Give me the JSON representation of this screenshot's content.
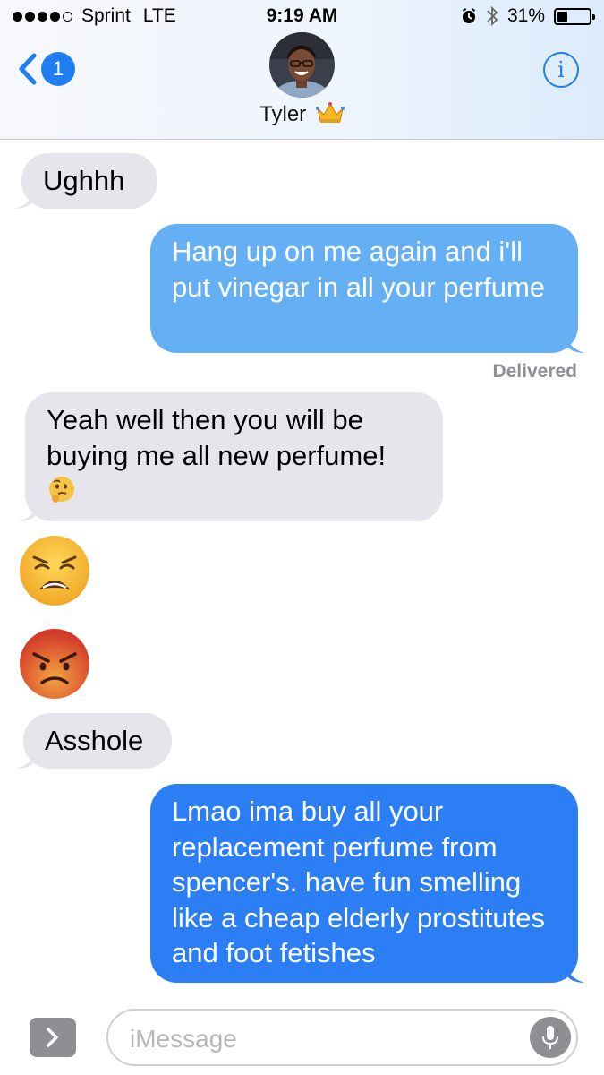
{
  "status_bar": {
    "carrier": "Sprint",
    "network": "LTE",
    "time": "9:19 AM",
    "battery": "31%",
    "battery_level": 0.31
  },
  "header": {
    "back_badge": "1",
    "contact_name": "Tyler",
    "info_glyph": "i"
  },
  "messages": [
    {
      "side": "incoming",
      "text": "Ughhh"
    },
    {
      "side": "outgoing",
      "text": "Hang up on me again and i'll put vinegar in all your perfume"
    },
    {
      "side": "incoming",
      "text": "Yeah well then you will be buying me all new perfume!",
      "emoji": "thinking-face"
    },
    {
      "side": "incoming",
      "emoji": "weary-face"
    },
    {
      "side": "incoming",
      "emoji": "angry-face"
    },
    {
      "side": "incoming",
      "text": "Asshole"
    },
    {
      "side": "outgoing",
      "text": "Lmao ima buy all your replacement perfume from spencer's. have fun smelling like a cheap elderly prostitutes and foot fetishes"
    }
  ],
  "delivered_label": "Delivered",
  "composer": {
    "placeholder": "iMessage"
  },
  "colors": {
    "incoming_bubble": "#e6e5eb",
    "outgoing_bubble_light": "#65aff5",
    "outgoing_bubble_dark": "#2c7ef5",
    "accent": "#1f7ef2"
  }
}
